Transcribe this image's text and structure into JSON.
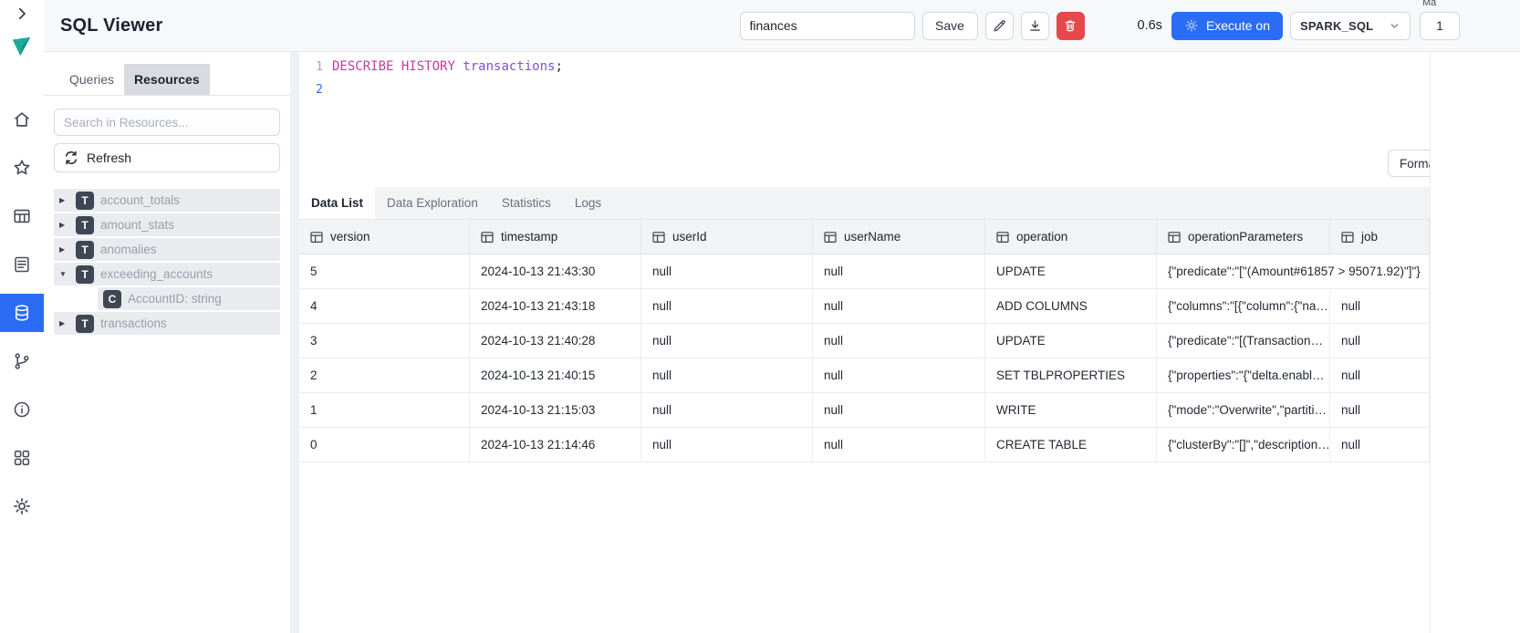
{
  "header": {
    "title": "SQL Viewer",
    "query_name_value": "finances",
    "save_label": "Save",
    "duration": "0.6s",
    "execute_label": "Execute on",
    "engine_value": "SPARK_SQL",
    "partial_button_label": "1",
    "corner_text": "Ma"
  },
  "rail": {
    "icons": [
      "chevron-right",
      "app-logo",
      "home",
      "star",
      "table",
      "document",
      "database",
      "git-fork",
      "info",
      "apps",
      "gear"
    ],
    "active_item": "database"
  },
  "sidebar": {
    "tabs": [
      {
        "label": "Queries",
        "active": false
      },
      {
        "label": "Resources",
        "active": true
      }
    ],
    "search_placeholder": "Search in Resources...",
    "refresh_label": "Refresh",
    "icons": {
      "caret_collapsed": "▶",
      "caret_expanded": "▼"
    },
    "tree": [
      {
        "type": "table",
        "badge": "T",
        "label": "account_totals",
        "expanded": false
      },
      {
        "type": "table",
        "badge": "T",
        "label": "amount_stats",
        "expanded": false
      },
      {
        "type": "table",
        "badge": "T",
        "label": "anomalies",
        "expanded": false
      },
      {
        "type": "table",
        "badge": "T",
        "label": "exceeding_accounts",
        "expanded": true,
        "children": [
          {
            "type": "column",
            "badge": "C",
            "label": "AccountID: string"
          }
        ]
      },
      {
        "type": "table",
        "badge": "T",
        "label": "transactions",
        "expanded": false
      }
    ]
  },
  "editor": {
    "format_label": "Format",
    "lines": [
      {
        "number": "1",
        "active": false,
        "tokens": [
          {
            "t": "DESCRIBE",
            "c": "keyword"
          },
          {
            "t": " ",
            "c": "plain"
          },
          {
            "t": "HISTORY",
            "c": "keyword"
          },
          {
            "t": " ",
            "c": "plain"
          },
          {
            "t": "transactions",
            "c": "ident"
          },
          {
            "t": ";",
            "c": "plain"
          }
        ]
      },
      {
        "number": "2",
        "active": true,
        "tokens": []
      }
    ]
  },
  "results": {
    "tabs": [
      {
        "label": "Data List",
        "active": true
      },
      {
        "label": "Data Exploration",
        "active": false
      },
      {
        "label": "Statistics",
        "active": false
      },
      {
        "label": "Logs",
        "active": false
      }
    ],
    "table": {
      "columns": [
        "version",
        "timestamp",
        "userId",
        "userName",
        "operation",
        "operationParameters",
        "job"
      ],
      "rows": [
        [
          "5",
          "2024-10-13 21:43:30",
          "null",
          "null",
          "UPDATE",
          "{\"predicate\":\"[\"(Amount#61857 > 95071.92)\"]\"}",
          ""
        ],
        [
          "4",
          "2024-10-13 21:43:18",
          "null",
          "null",
          "ADD COLUMNS",
          "{\"columns\":\"[{\"column\":{\"na…",
          "null"
        ],
        [
          "3",
          "2024-10-13 21:40:28",
          "null",
          "null",
          "UPDATE",
          "{\"predicate\":\"[(Transaction…",
          "null"
        ],
        [
          "2",
          "2024-10-13 21:40:15",
          "null",
          "null",
          "SET TBLPROPERTIES",
          "{\"properties\":\"{\"delta.enabl…",
          "null"
        ],
        [
          "1",
          "2024-10-13 21:15:03",
          "null",
          "null",
          "WRITE",
          "{\"mode\":\"Overwrite\",\"partiti…",
          "null"
        ],
        [
          "0",
          "2024-10-13 21:14:46",
          "null",
          "null",
          "CREATE TABLE",
          "{\"clusterBy\":\"[]\",\"description…",
          "null"
        ]
      ]
    }
  }
}
